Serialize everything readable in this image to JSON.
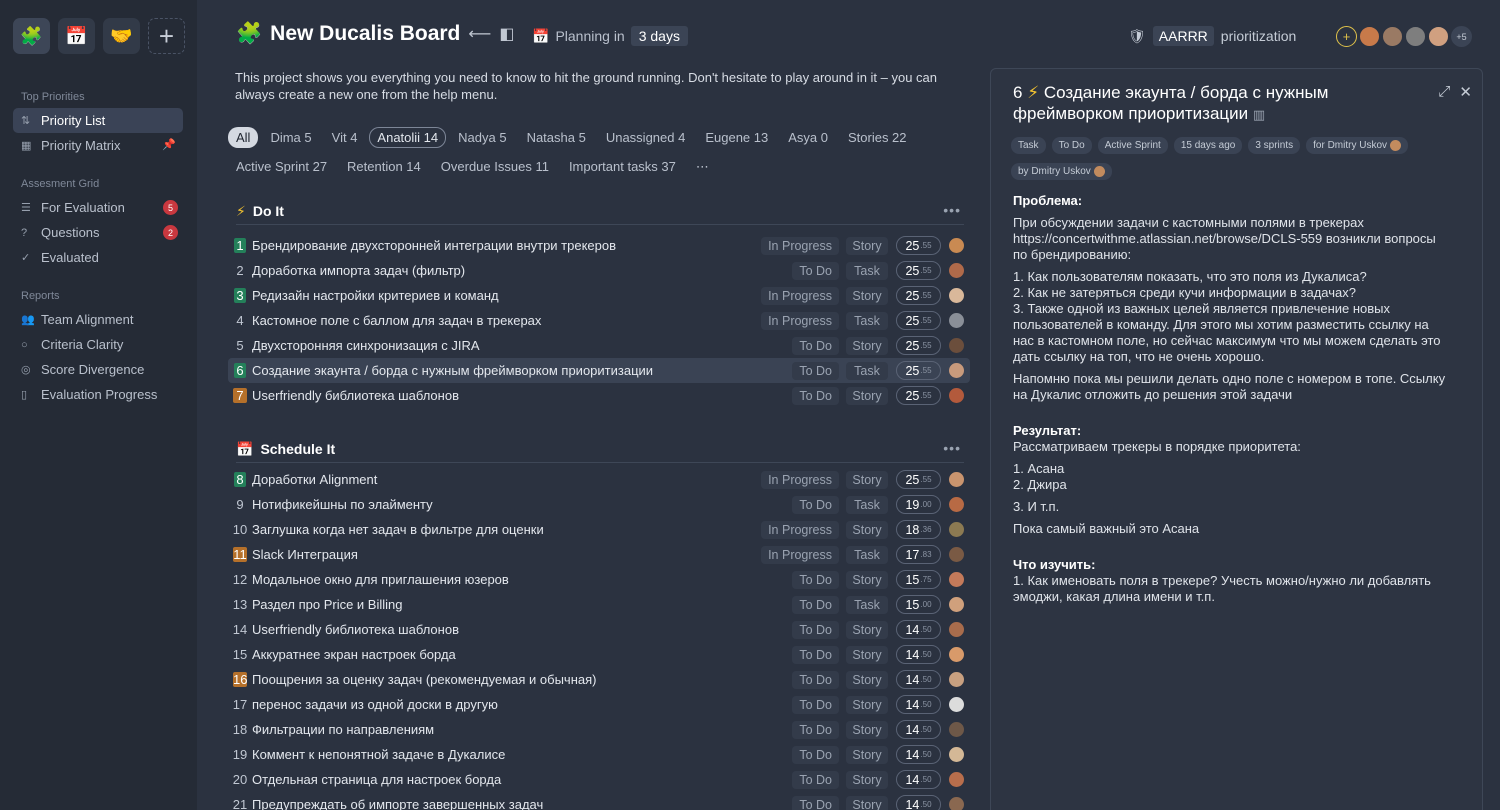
{
  "sidebar": {
    "apps": [
      {
        "name": "ducalis-app-icon",
        "glyph": "🧩"
      },
      {
        "name": "calendar-app-icon",
        "glyph": "📅"
      },
      {
        "name": "handshake-app-icon",
        "glyph": "🤝"
      },
      {
        "name": "add-app-icon",
        "glyph": "+"
      }
    ],
    "sections": {
      "top": "Top Priorities",
      "assessment": "Assesment Grid",
      "reports": "Reports"
    },
    "items": {
      "priority_list": "Priority List",
      "priority_matrix": "Priority Matrix",
      "for_evaluation": "For Evaluation",
      "for_evaluation_badge": "5",
      "questions": "Questions",
      "questions_badge": "2",
      "evaluated": "Evaluated",
      "team_alignment": "Team Alignment",
      "criteria_clarity": "Criteria Clarity",
      "score_divergence": "Score Divergence",
      "evaluation_progress": "Evaluation Progress"
    }
  },
  "header": {
    "board_title": "New Ducalis Board",
    "planning_label": "Planning in",
    "planning_days": "3 days",
    "framework_tag": "AARRR",
    "framework_label": "prioritization",
    "more_members": "+5"
  },
  "description": "This project shows you everything you need to know to hit the ground running. Don't hesitate to play around in it – you can always create a new one from the help menu.",
  "filters": [
    "All",
    "Dima 5",
    "Vit 4",
    "Anatolii 14",
    "Nadya 5",
    "Natasha 5",
    "Unassigned 4",
    "Eugene 13",
    "Asya 0",
    "Stories 22",
    "Active Sprint 27",
    "Retention 14",
    "Overdue Issues 11",
    "Important tasks 37",
    "⋯"
  ],
  "groups": {
    "do_it": "Do It",
    "schedule_it": "Schedule It"
  },
  "do_it_rows": [
    {
      "num": "1",
      "title": "Брендирование двухсторонней интеграции внутри трекеров",
      "status": "In Progress",
      "type": "Story",
      "score": "25",
      "dec": ".55",
      "color": "#c98a52"
    },
    {
      "num": "2",
      "title": "Доработка импорта задач (фильтр)",
      "status": "To Do",
      "type": "Task",
      "score": "25",
      "dec": ".55",
      "color": "#b06a4a"
    },
    {
      "num": "3",
      "title": "Редизайн настройки критериев и команд",
      "status": "In Progress",
      "type": "Story",
      "score": "25",
      "dec": ".55",
      "color": "#d9b89a"
    },
    {
      "num": "4",
      "title": "Кастомное поле с баллом для задач в трекерах",
      "status": "In Progress",
      "type": "Task",
      "score": "25",
      "dec": ".55",
      "color": "#8a8f98"
    },
    {
      "num": "5",
      "title": "Двухсторонняя синхронизация с JIRA",
      "status": "To Do",
      "type": "Story",
      "score": "25",
      "dec": ".55",
      "color": "#6b4e3c"
    },
    {
      "num": "6",
      "title": "Создание экаунта / борда с нужным фреймворком приоритизации",
      "status": "To Do",
      "type": "Task",
      "score": "25",
      "dec": ".55",
      "color": "#c89a7c"
    },
    {
      "num": "7",
      "title": "Userfriendly библиотека шаблонов",
      "status": "To Do",
      "type": "Story",
      "score": "25",
      "dec": ".55",
      "color": "#b35a3c"
    }
  ],
  "schedule_rows": [
    {
      "num": "8",
      "title": "Доработки Alignment",
      "status": "In Progress",
      "type": "Story",
      "score": "25",
      "dec": ".55",
      "color": "#c9946e"
    },
    {
      "num": "9",
      "title": "Нотификейшны по элайменту",
      "status": "To Do",
      "type": "Task",
      "score": "19",
      "dec": ".00",
      "color": "#b86a44"
    },
    {
      "num": "10",
      "title": "Заглушка когда нет задач в фильтре для оценки",
      "status": "In Progress",
      "type": "Story",
      "score": "18",
      "dec": ".36",
      "color": "#8c7a52"
    },
    {
      "num": "11",
      "title": "Slack Интеграция",
      "status": "In Progress",
      "type": "Task",
      "score": "17",
      "dec": ".83",
      "color": "#7a5a44"
    },
    {
      "num": "12",
      "title": "Модальное окно для приглашения юзеров",
      "status": "To Do",
      "type": "Story",
      "score": "15",
      "dec": ".75",
      "color": "#c47a5a"
    },
    {
      "num": "13",
      "title": "Раздел про Price и Billing",
      "status": "To Do",
      "type": "Task",
      "score": "15",
      "dec": ".00",
      "color": "#d0a07c"
    },
    {
      "num": "14",
      "title": "Userfriendly библиотека шаблонов",
      "status": "To Do",
      "type": "Story",
      "score": "14",
      "dec": ".50",
      "color": "#a86c4c"
    },
    {
      "num": "15",
      "title": "Аккуратнее экран настроек борда",
      "status": "To Do",
      "type": "Story",
      "score": "14",
      "dec": ".50",
      "color": "#d89a6a"
    },
    {
      "num": "16",
      "title": "Поощрения за оценку задач (рекомендуемая и обычная)",
      "status": "To Do",
      "type": "Story",
      "score": "14",
      "dec": ".50",
      "color": "#c8a080"
    },
    {
      "num": "17",
      "title": "перенос задачи из одной доски в другую",
      "status": "To Do",
      "type": "Story",
      "score": "14",
      "dec": ".50",
      "color": "#dcdcdc"
    },
    {
      "num": "18",
      "title": "Фильтрации по направлениям",
      "status": "To Do",
      "type": "Story",
      "score": "14",
      "dec": ".50",
      "color": "#6e5848"
    },
    {
      "num": "19",
      "title": "Коммент к непонятной задаче в Дукалисе",
      "status": "To Do",
      "type": "Story",
      "score": "14",
      "dec": ".50",
      "color": "#d4b896"
    },
    {
      "num": "20",
      "title": "Отдельная страница для настроек борда",
      "status": "To Do",
      "type": "Story",
      "score": "14",
      "dec": ".50",
      "color": "#b86e4c"
    },
    {
      "num": "21",
      "title": "Предупреждать об импорте завершенных задач",
      "status": "To Do",
      "type": "Story",
      "score": "14",
      "dec": ".50",
      "color": "#8a6850"
    }
  ],
  "panel": {
    "num": "6",
    "title": "Создание экаунта / борда с нужным фреймворком приоритизации",
    "chips": [
      "Task",
      "To Do",
      "Active Sprint",
      "15 days ago",
      "3 sprints"
    ],
    "for_chip": "for Dmitry Uskov",
    "by_chip": "by Dmitry Uskov",
    "problem_h": "Проблема:",
    "problem_p1": "При обсуждении задачи с кастомными полями в трекерах https://concertwithme.atlassian.net/browse/DCLS-559 возникли вопросы по брендированию:",
    "problem_l1": "1. Как пользователям показать, что это поля из Дукалиса?",
    "problem_l2": "2. Как не затеряться среди кучи информации в задачах?",
    "problem_l3": "3. Также одной из важных целей является привлечение новых пользователей в команду. Для этого мы хотим разместить ссылку на нас в кастомном поле, но сейчас максимум что мы можем сделать это дать ссылку на топ, что не очень хорошо.",
    "problem_p2": "Напомню пока мы решили делать одно поле с номером в топе. Ссылку на Дукалис отложить до решения этой задачи",
    "result_h": "Результат:",
    "result_p": "Рассматриваем трекеры в порядке приоритета:",
    "result_l1": "1. Асана",
    "result_l2": "2. Джира",
    "result_l3": "3. И т.п.",
    "result_p2": "Пока самый важный это Асана",
    "study_h": "Что изучить:",
    "study_p": "1. Как именовать поля в трекере? Учесть можно/нужно ли добавлять эмоджи, какая длина имени и т.п."
  }
}
